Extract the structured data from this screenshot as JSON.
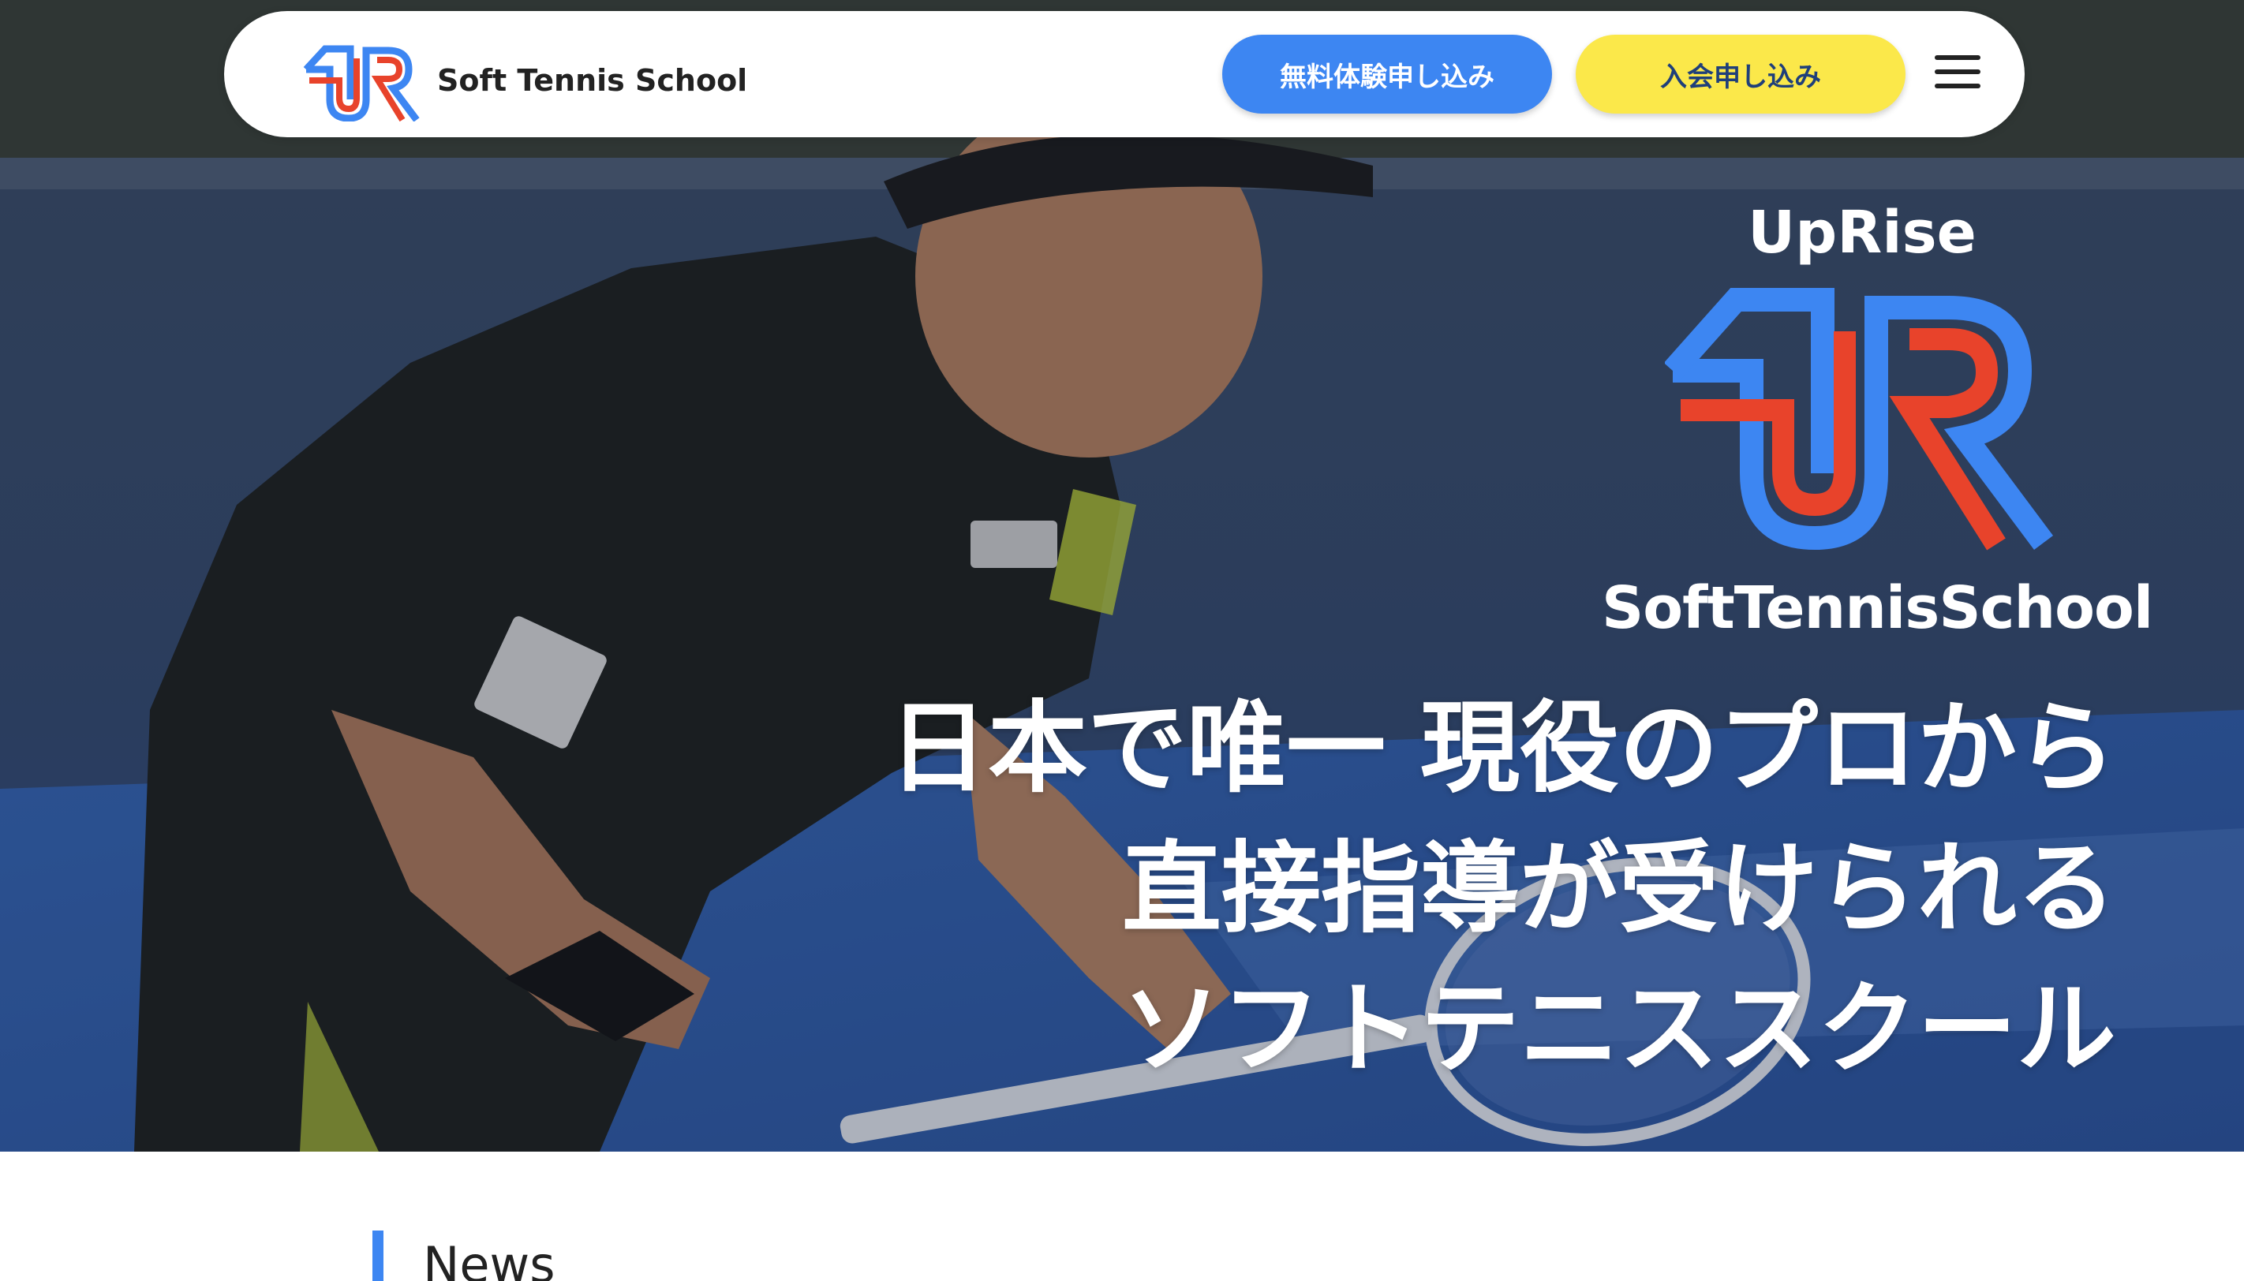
{
  "header": {
    "brand": "Soft Tennis School",
    "trial_button": "無料体験申し込み",
    "join_button": "入会申し込み",
    "menu_icon": "hamburger-icon",
    "logo_icon": "uprise-ur-logo-icon"
  },
  "hero": {
    "logo_top": "UpRise",
    "logo_bottom": "SoftTennisSchool",
    "tagline_lines": [
      "日本で唯一 現役のプロから",
      "直接指導が受けられる",
      "ソフトテニススクール"
    ]
  },
  "news": {
    "heading": "News"
  },
  "colors": {
    "logo_blue": "#3d86f2",
    "logo_red": "#e8432b",
    "trial_button_bg": "#3d86f2",
    "join_button_bg": "#fbe84a",
    "join_button_text": "#1f3f7a",
    "news_accent": "#3d86f2"
  }
}
